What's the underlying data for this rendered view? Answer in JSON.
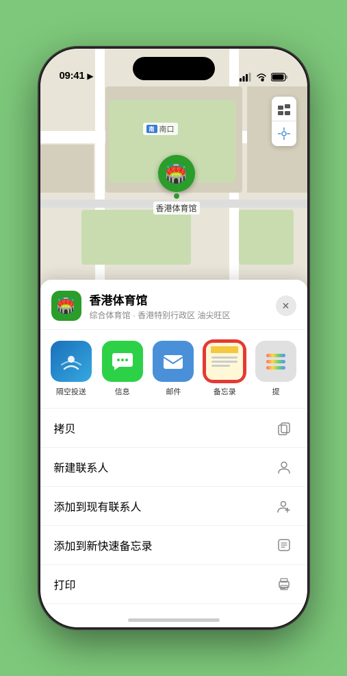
{
  "statusBar": {
    "time": "09:41",
    "locationIcon": "▶"
  },
  "map": {
    "entrance_label": "南口",
    "entrance_prefix": "南",
    "pin_label": "香港体育馆",
    "pin_emoji": "🏟️"
  },
  "sheet": {
    "venue_name": "香港体育馆",
    "venue_subtitle": "综合体育馆 · 香港特别行政区 油尖旺区",
    "close_char": "✕"
  },
  "shareActions": [
    {
      "id": "airdrop",
      "label": "隔空投送",
      "type": "airdrop"
    },
    {
      "id": "message",
      "label": "信息",
      "type": "message"
    },
    {
      "id": "mail",
      "label": "邮件",
      "type": "mail"
    },
    {
      "id": "notes",
      "label": "备忘录",
      "type": "notes"
    },
    {
      "id": "more",
      "label": "提",
      "type": "more"
    }
  ],
  "menuItems": [
    {
      "id": "copy",
      "label": "拷贝",
      "icon": "copy"
    },
    {
      "id": "new-contact",
      "label": "新建联系人",
      "icon": "person"
    },
    {
      "id": "add-contact",
      "label": "添加到现有联系人",
      "icon": "person-add"
    },
    {
      "id": "quick-note",
      "label": "添加到新快速备忘录",
      "icon": "quick-note"
    },
    {
      "id": "print",
      "label": "打印",
      "icon": "print"
    }
  ]
}
